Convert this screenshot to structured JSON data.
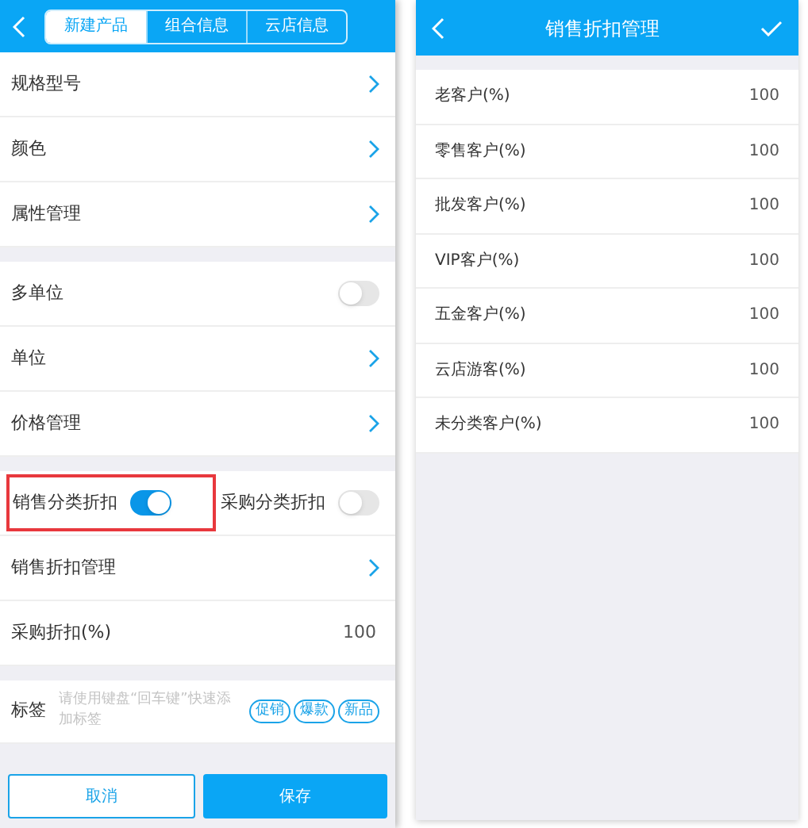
{
  "product_screen": {
    "tabs": [
      {
        "label": "新建产品",
        "selected": true
      },
      {
        "label": "组合信息",
        "selected": false
      },
      {
        "label": "云店信息",
        "selected": false
      }
    ],
    "sections": [
      [
        {
          "kind": "link",
          "label": "规格型号"
        },
        {
          "kind": "link",
          "label": "颜色"
        },
        {
          "kind": "link",
          "label": "属性管理"
        }
      ],
      [
        {
          "kind": "switch",
          "label": "多单位",
          "on": false
        },
        {
          "kind": "link",
          "label": "单位"
        },
        {
          "kind": "link",
          "label": "价格管理"
        }
      ],
      [
        {
          "kind": "switch_pair",
          "switches": [
            {
              "label": "销售分类折扣",
              "on": true,
              "highlighted": true
            },
            {
              "label": "采购分类折扣",
              "on": false,
              "highlighted": false
            }
          ]
        },
        {
          "kind": "link",
          "label": "销售折扣管理"
        },
        {
          "kind": "value",
          "label": "采购折扣(%)",
          "value": "100"
        }
      ],
      [
        {
          "kind": "tags",
          "label": "标签",
          "placeholder": "请使用键盘“回车键”快速添加标签",
          "tags": [
            "促销",
            "爆款",
            "新品"
          ]
        }
      ]
    ],
    "buttons": {
      "cancel": "取消",
      "save": "保存"
    }
  },
  "discount_screen": {
    "title": "销售折扣管理",
    "rows": [
      {
        "label": "老客户(%)",
        "value": "100"
      },
      {
        "label": "零售客户(%)",
        "value": "100"
      },
      {
        "label": "批发客户(%)",
        "value": "100"
      },
      {
        "label": "VIP客户(%)",
        "value": "100"
      },
      {
        "label": "五金客户(%)",
        "value": "100"
      },
      {
        "label": "云店游客(%)",
        "value": "100"
      },
      {
        "label": "未分类客户(%)",
        "value": "100"
      }
    ]
  }
}
